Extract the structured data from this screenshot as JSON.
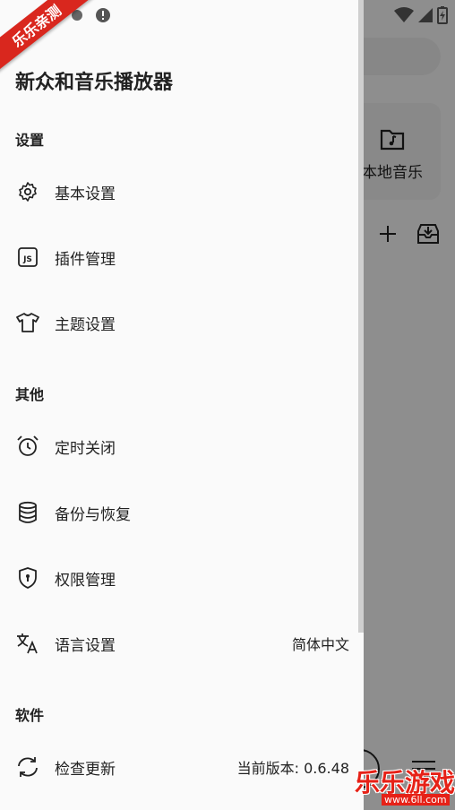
{
  "drawer": {
    "title": "新众和音乐播放器",
    "sections": [
      {
        "header": "设置"
      },
      {
        "header": "其他"
      },
      {
        "header": "软件"
      }
    ],
    "items": {
      "basic_settings": {
        "label": "基本设置",
        "icon": "gear-icon"
      },
      "plugin_management": {
        "label": "插件管理",
        "icon": "js-icon"
      },
      "theme_settings": {
        "label": "主题设置",
        "icon": "tshirt-icon"
      },
      "sleep_timer": {
        "label": "定时关闭",
        "icon": "alarm-clock-icon"
      },
      "backup_restore": {
        "label": "备份与恢复",
        "icon": "database-icon"
      },
      "permission_management": {
        "label": "权限管理",
        "icon": "shield-icon"
      },
      "language_settings": {
        "label": "语言设置",
        "value": "简体中文",
        "icon": "translate-icon"
      },
      "check_update": {
        "label": "检查更新",
        "value": "当前版本: 0.6.48",
        "icon": "refresh-icon"
      }
    }
  },
  "background": {
    "local_music_label": "本地音乐"
  },
  "watermark": {
    "ribbon": "乐乐亲测",
    "brand": "乐乐游戏",
    "url": "www.6ll.com"
  },
  "colors": {
    "accent_red": "#d9271e",
    "text": "#222222",
    "drawer_bg": "#fafafa"
  }
}
